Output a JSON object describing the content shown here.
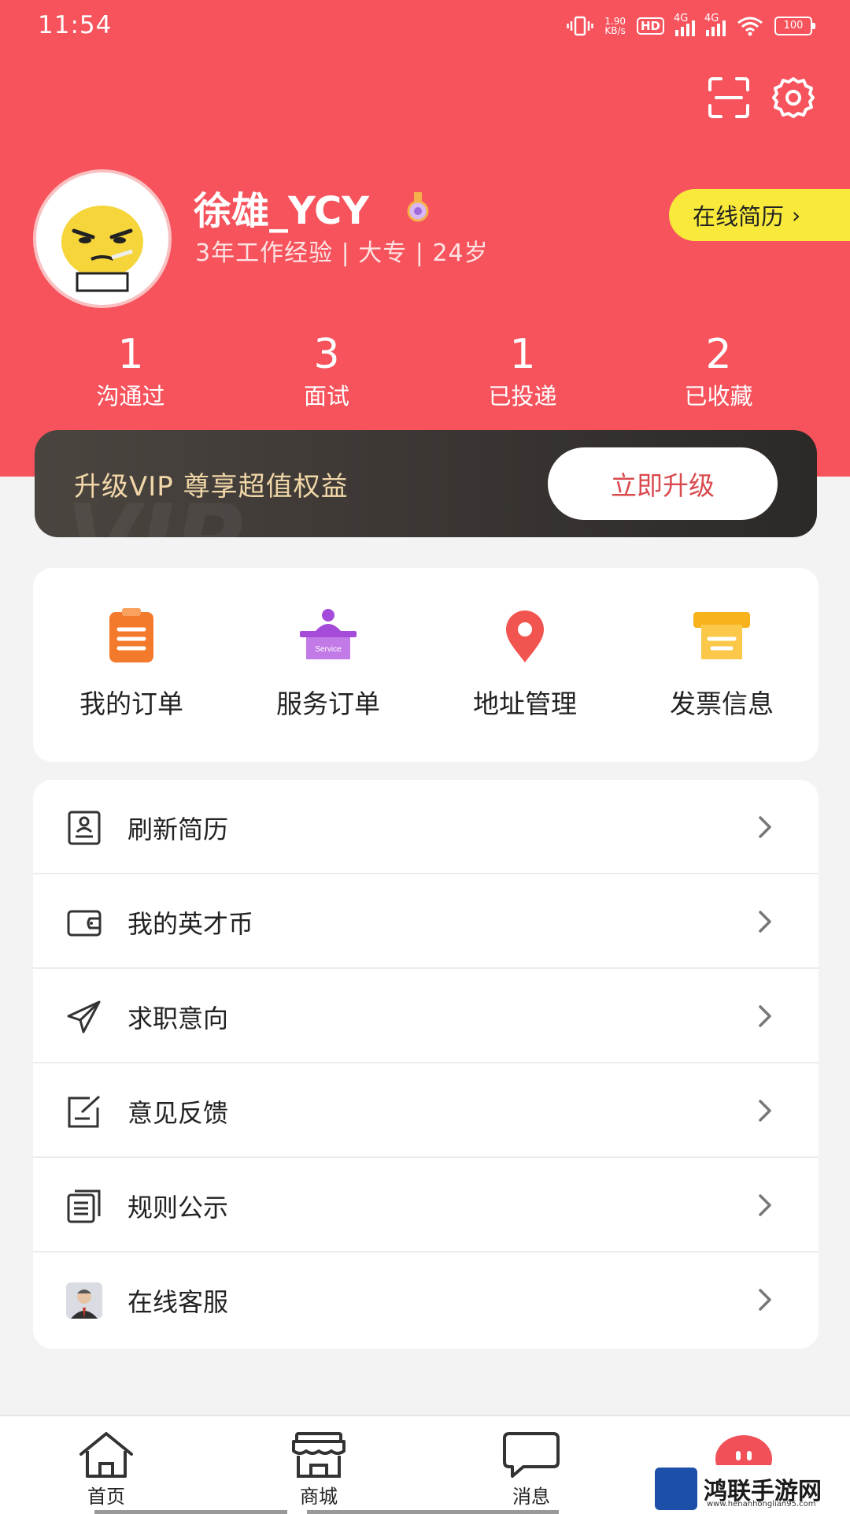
{
  "status_bar": {
    "time": "11:54",
    "net_speed_value": "1.90",
    "net_speed_unit": "KB/s",
    "hd": "HD",
    "sim1": "4G",
    "sim2": "4G",
    "battery": "100"
  },
  "profile": {
    "name": "徐雄_YCY",
    "meta": "3年工作经验 | 大专 | 24岁",
    "resume_button": "在线简历",
    "resume_chevron": "›"
  },
  "stats": [
    {
      "value": "1",
      "label": "沟通过"
    },
    {
      "value": "3",
      "label": "面试"
    },
    {
      "value": "1",
      "label": "已投递"
    },
    {
      "value": "2",
      "label": "已收藏"
    }
  ],
  "vip": {
    "text": "升级VIP 尊享超值权益",
    "button": "立即升级",
    "watermark": "VIP"
  },
  "services": [
    {
      "label": "我的订单",
      "icon": "clipboard-icon",
      "color": "#f47a2b"
    },
    {
      "label": "服务订单",
      "icon": "service-desk-icon",
      "color": "#a54bd9",
      "icon_text": "Service"
    },
    {
      "label": "地址管理",
      "icon": "location-pin-icon",
      "color": "#f2544f"
    },
    {
      "label": "发票信息",
      "icon": "invoice-icon",
      "color": "#f7b21c"
    }
  ],
  "menu": [
    {
      "label": "刷新简历",
      "icon": "resume-icon"
    },
    {
      "label": "我的英才币",
      "icon": "wallet-icon"
    },
    {
      "label": "求职意向",
      "icon": "paper-plane-icon"
    },
    {
      "label": "意见反馈",
      "icon": "feedback-icon"
    },
    {
      "label": "规则公示",
      "icon": "document-icon"
    },
    {
      "label": "在线客服",
      "icon": "customer-service-avatar-icon"
    }
  ],
  "bottom_nav": [
    {
      "label": "首页",
      "icon": "home-icon"
    },
    {
      "label": "商城",
      "icon": "store-icon"
    },
    {
      "label": "消息",
      "icon": "message-icon"
    },
    {
      "label": "",
      "icon": "profile-face-icon"
    }
  ],
  "watermark": {
    "text": "鸿联手游网",
    "url": "www.henanhonglian95.com"
  },
  "colors": {
    "brand_red": "#f6535c",
    "vip_gold": "#f1d7a8",
    "resume_yellow": "#f8e93b"
  }
}
